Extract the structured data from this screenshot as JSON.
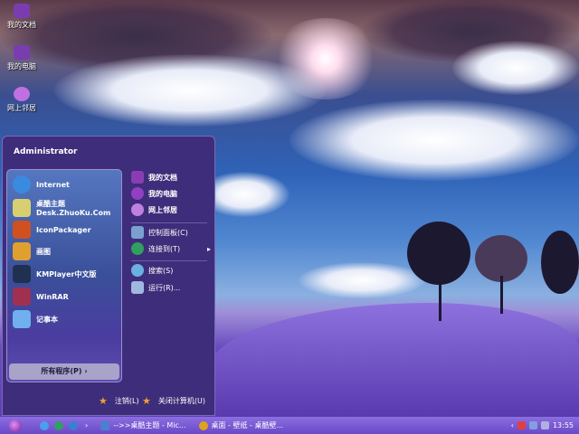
{
  "desktop_icons": [
    {
      "label": "我的文档"
    },
    {
      "label": "我的电脑"
    },
    {
      "label": "网上邻居"
    }
  ],
  "start_menu": {
    "user": "Administrator",
    "pinned": [
      {
        "label": "Internet",
        "icon": "ie-icon"
      },
      {
        "label": "桌酷主题",
        "sub": "Desk.ZhuoKu.Com",
        "icon": "theme-icon"
      },
      {
        "label": "IconPackager",
        "icon": "iconpackager-icon"
      },
      {
        "label": "画图",
        "icon": "paint-icon"
      },
      {
        "label": "KMPlayer中文版",
        "icon": "kmplayer-icon"
      },
      {
        "label": "WinRAR",
        "icon": "winrar-icon"
      },
      {
        "label": "记事本",
        "icon": "notepad-icon"
      }
    ],
    "all_programs": "所有程序(P)",
    "right": [
      {
        "label": "我的文档"
      },
      {
        "label": "我的电脑"
      },
      {
        "label": "网上邻居"
      },
      {
        "label": "控制面板(C)"
      },
      {
        "label": "连接到(T)"
      },
      {
        "label": "搜索(S)"
      },
      {
        "label": "运行(R)..."
      }
    ],
    "logoff": "注销(L)",
    "shutdown": "关闭计算机(U)"
  },
  "taskbar": {
    "tasks": [
      {
        "label": "-->>桌酷主题 - Mic..."
      },
      {
        "label": "桌面 - 壁纸 - 桌酷壁..."
      }
    ],
    "clock": "13:55"
  }
}
